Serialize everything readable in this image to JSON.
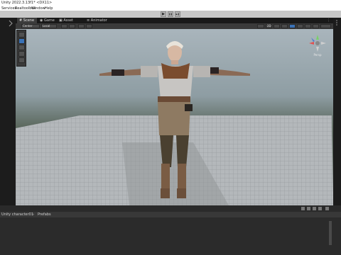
{
  "window": {
    "title": "Unity 2022.3.13f1* <DX11>"
  },
  "menu": [
    "Services",
    "Realtoolbox",
    "Window",
    "Help"
  ],
  "playbar": {
    "play_icon": "▶",
    "pause_icon": "❚❚",
    "step_icon": "▶❚"
  },
  "tabs": [
    {
      "label": "Scene",
      "active": true
    },
    {
      "label": "Game",
      "active": false
    },
    {
      "label": "Asset Store",
      "active": false
    },
    {
      "label": "Animator",
      "active": false
    }
  ],
  "scene_toolbar": {
    "pivot_label": "Center",
    "local_label": "Local",
    "view_2d_label": "2D"
  },
  "gizmo": {
    "label": "Persp"
  },
  "breadcrumb": {
    "prefix": "...",
    "object": "Unity character01",
    "separator": "›",
    "mode": "Prefabs"
  },
  "colors": {
    "accent": "#3a72b6",
    "background": "#1e1e1e"
  }
}
